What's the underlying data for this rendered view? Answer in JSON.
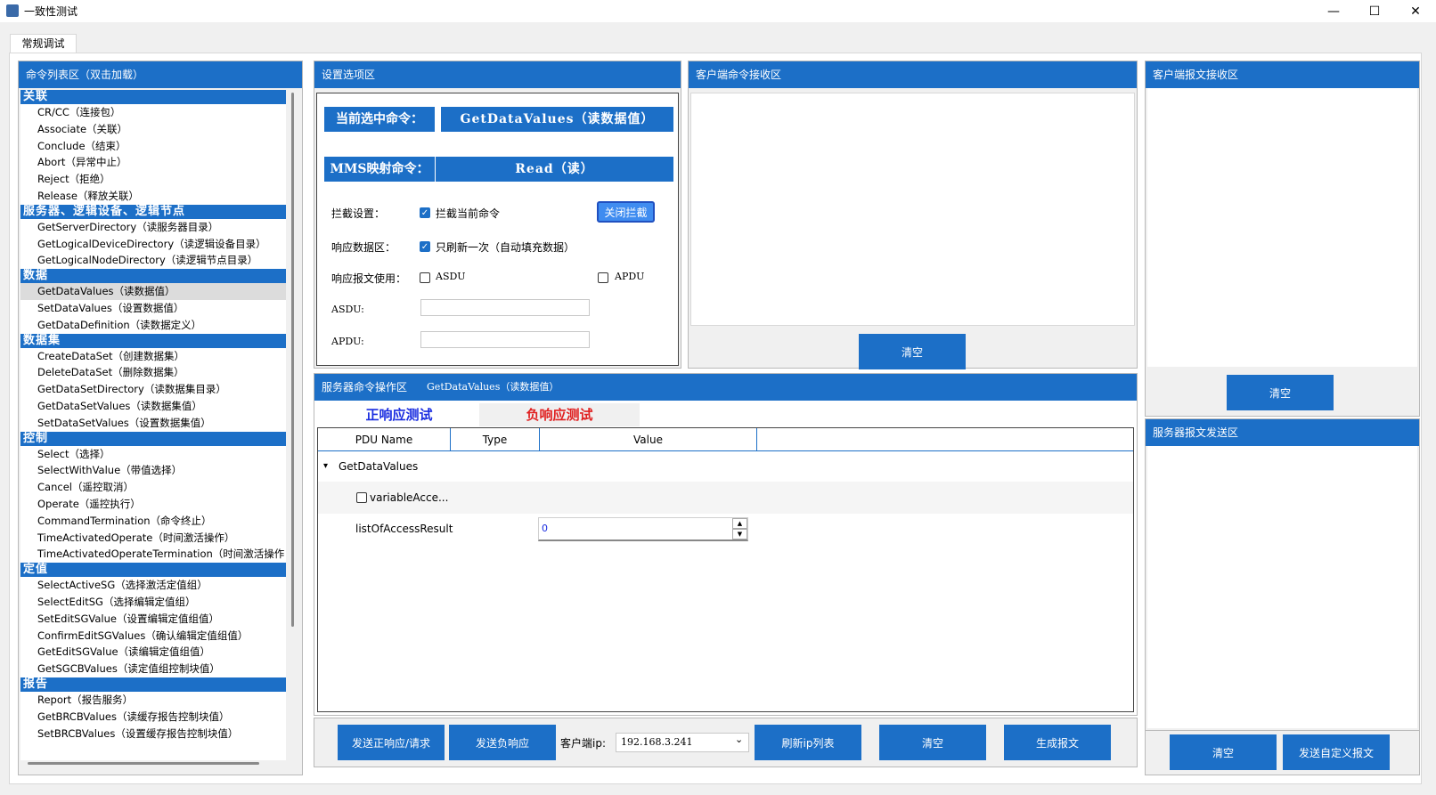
{
  "window": {
    "title": "一致性测试",
    "minimize": "—",
    "maximize": "☐",
    "close": "✕"
  },
  "tab": {
    "label": "常规调试"
  },
  "cmd_panel": {
    "title": "命令列表区（双击加载）",
    "groups": [
      {
        "name": "关联",
        "items": [
          "CR/CC（连接包）",
          "Associate（关联）",
          "Conclude（结束）",
          "Abort（异常中止）",
          "Reject（拒绝）",
          "Release（释放关联）"
        ]
      },
      {
        "name": "服务器、逻辑设备、逻辑节点",
        "items": [
          "GetServerDirectory（读服务器目录）",
          "GetLogicalDeviceDirectory（读逻辑设备目录）",
          "GetLogicalNodeDirectory（读逻辑节点目录）"
        ]
      },
      {
        "name": "数据",
        "items": [
          "GetDataValues（读数据值）",
          "SetDataValues（设置数据值）",
          "GetDataDefinition（读数据定义）"
        ]
      },
      {
        "name": "数据集",
        "items": [
          "CreateDataSet（创建数据集）",
          "DeleteDataSet（删除数据集）",
          "GetDataSetDirectory（读数据集目录）",
          "GetDataSetValues（读数据集值）",
          "SetDataSetValues（设置数据集值）"
        ]
      },
      {
        "name": "控制",
        "items": [
          "Select（选择）",
          "SelectWithValue（带值选择）",
          "Cancel（遥控取消）",
          "Operate（遥控执行）",
          "CommandTermination（命令终止）",
          "TimeActivatedOperate（时间激活操作）",
          "TimeActivatedOperateTermination（时间激活操作"
        ]
      },
      {
        "name": "定值",
        "items": [
          "SelectActiveSG（选择激活定值组）",
          "SelectEditSG（选择编辑定值组）",
          "SetEditSGValue（设置编辑定值组值）",
          "ConfirmEditSGValues（确认编辑定值组值）",
          "GetEditSGValue（读编辑定值组值）",
          "GetSGCBValues（读定值组控制块值）"
        ]
      },
      {
        "name": "报告",
        "items": [
          "Report（报告服务）",
          "GetBRCBValues（读缓存报告控制块值）",
          "SetBRCBValues（设置缓存报告控制块值）"
        ]
      }
    ],
    "selected": "GetDataValues（读数据值）"
  },
  "settings": {
    "title": "设置选项区",
    "current_cmd_label": "当前选中命令：",
    "current_cmd_value": "GetDataValues（读数据值）",
    "mms_label": "MMS映射命令：",
    "mms_value": "Read（读）",
    "intercept_label": "拦截设置：",
    "intercept_check": "拦截当前命令",
    "intercept_button": "关闭拦截",
    "resp_data_label": "响应数据区：",
    "resp_data_check": "只刷新一次（自动填充数据）",
    "resp_use_label": "响应报文使用：",
    "asdu_check": "ASDU",
    "apdu_check": "APDU",
    "asdu_label": "ASDU:",
    "apdu_label": "APDU:",
    "asdu_value": "",
    "apdu_value": ""
  },
  "client_cmd": {
    "title": "客户端命令接收区",
    "clear": "清空"
  },
  "client_msg": {
    "title": "客户端报文接收区",
    "clear": "清空"
  },
  "server_op": {
    "title": "服务器命令操作区",
    "subtitle": "GetDataValues（读数据值）",
    "tab_pos": "正响应测试",
    "tab_neg": "负响应测试",
    "col_pdu": "PDU Name",
    "col_type": "Type",
    "col_value": "Value",
    "tree_root": "GetDataValues",
    "row1": "variableAcce...",
    "row2": "listOfAccessResult",
    "row2_value": "0",
    "stepper_up": "▲",
    "stepper_down": "▼",
    "btn_send_pos": "发送正响应/请求",
    "btn_send_neg": "发送负响应",
    "client_ip_label": "客户端ip:",
    "client_ip_value": "192.168.3.241",
    "btn_refresh": "刷新ip列表",
    "btn_clear": "清空",
    "btn_gen": "生成报文"
  },
  "server_send": {
    "title": "服务器报文发送区",
    "clear": "清空",
    "send_custom": "发送自定义报文"
  },
  "colors": {
    "accent": "#1c6fc7",
    "red_tab": "#e02020",
    "blue_tab": "#1a2de0"
  }
}
